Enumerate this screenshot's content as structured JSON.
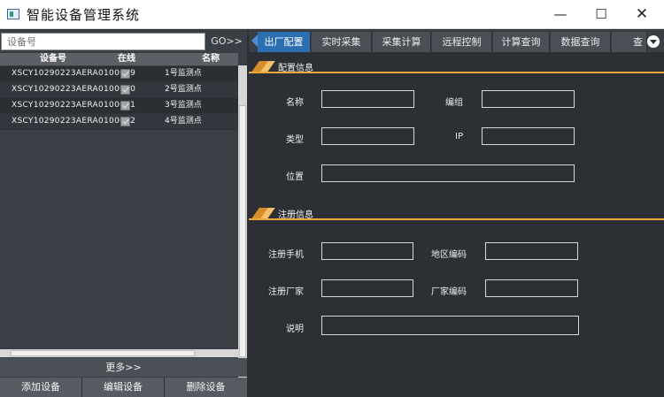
{
  "window": {
    "title": "智能设备管理系统",
    "min_icon": "minimize-icon",
    "max_icon": "maximize-icon",
    "close_icon": "close-icon",
    "min_glyph": "—",
    "max_glyph": "☐",
    "close_glyph": "✕"
  },
  "device_panel": {
    "search_placeholder": "设备号",
    "go_label": "GO>>",
    "columns": {
      "code": "设备号",
      "online": "在线",
      "name": "名称"
    },
    "devices": [
      {
        "code": "XSCY10290223AERA0100089",
        "online": true,
        "name": "1号监测点"
      },
      {
        "code": "XSCY10290223AERA0100090",
        "online": true,
        "name": "2号监测点"
      },
      {
        "code": "XSCY10290223AERA0100091",
        "online": true,
        "name": "3号监测点"
      },
      {
        "code": "XSCY10290223AERA0100092",
        "online": true,
        "name": "4号监测点"
      }
    ],
    "more_label": "更多>>",
    "add_label": "添加设备",
    "edit_label": "编辑设备",
    "delete_label": "删除设备"
  },
  "tabs": {
    "items": [
      "出厂配置",
      "实时采集",
      "采集计算",
      "远程控制",
      "计算查询",
      "数据查询",
      "查"
    ],
    "active_index": 0,
    "more_icon": "chevron-down-icon"
  },
  "config_section": {
    "title": "配置信息",
    "name_label": "名称",
    "group_label": "编组",
    "type_label": "类型",
    "ip_label": "IP",
    "location_label": "位置"
  },
  "register_section": {
    "title": "注册信息",
    "phone_label": "注册手机",
    "region_label": "地区编码",
    "vendor_label": "注册厂家",
    "vendor_code_label": "厂家编码",
    "desc_label": "说明"
  },
  "colors": {
    "panel_bg": "#2c3035",
    "accent_orange": "#f0a63a",
    "tab_active": "#2c6fb0"
  }
}
